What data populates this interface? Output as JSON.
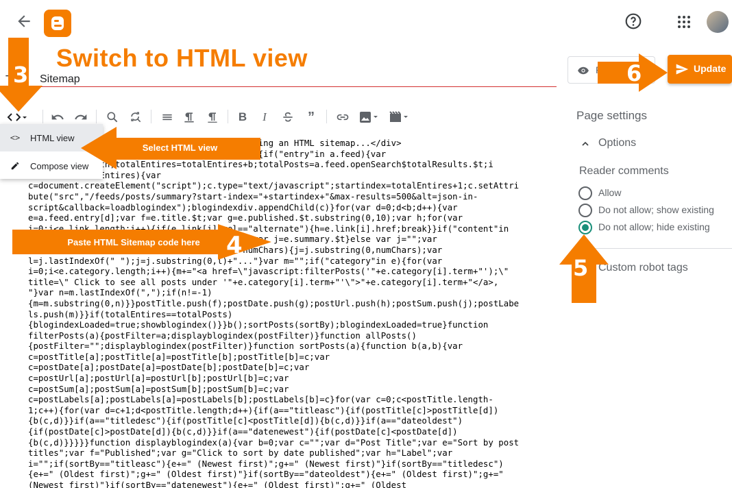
{
  "header": {
    "back_icon": "arrow-left-icon",
    "logo_icon": "blogger-logo-icon",
    "help_icon": "help-circle-icon",
    "apps_icon": "apps-grid-icon"
  },
  "title": {
    "prefix": "T",
    "text": "Sitemap"
  },
  "menu": {
    "html_view": "HTML view",
    "compose_view": "Compose view"
  },
  "code_lines": [
    "                                          lating an HTML sitemap...</div>",
    "                                          b(){if(\"entry\"in a.feed){var",
    "         .length;totalEntires=totalEntires+b;totalPosts=a.feed.openSearch$totalResults.$t;i",
    "         totalEntires){var",
    "c=document.createElement(\"script\");c.type=\"text/javascript\";startindex=totalEntires+1;c.setAttri",
    "bute(\"src\",\"/feeds/posts/summary?start-index=\"+startindex+\"&max-results=500&alt=json-in-",
    "script&callback=loadblogindex\");blogindexdiv.appendChild(c)}for(var d=0;d<b;d++){var",
    "e=a.feed.entry[d];var f=e.title.$t;var g=e.published.$t.substring(0,10);var h;for(var",
    "i=0;i<e.link.length;i++){if(e.link[i].rel==\"alternate\"){h=e.link[i].href;break}}if(\"content\"in",
    "                                          ){var j=e.summary.$t}else var j=\"\";var",
    "                                      gth>numChars){j=j.substring(0,numChars);var",
    "l=j.lastIndexOf(\" \");j=j.substring(0,l)+\"...\"}var m=\"\";if(\"category\"in e){for(var",
    "i=0;i<e.category.length;i++){m+=\"<a href=\\\"javascript:filterPosts('\"+e.category[i].term+\"');\\\"",
    "title=\\\" Click to see all posts under '\"+e.category[i].term+\"'\\\">\"+e.category[i].term+\"</a>,",
    "\"}var n=m.lastIndexOf(\",\");if(n!=-1)",
    "{m=m.substring(0,n)}}postTitle.push(f);postDate.push(g);postUrl.push(h);postSum.push(j);postLabe",
    "ls.push(m)}}if(totalEntires==totalPosts)",
    "{blogindexLoaded=true;showblogindex()}}b();sortPosts(sortBy);blogindexLoaded=true}function",
    "filterPosts(a){postFilter=a;displayblogindex(postFilter)}function allPosts()",
    "{postFilter=\"\";displayblogindex(postFilter)}function sortPosts(a){function b(a,b){var",
    "c=postTitle[a];postTitle[a]=postTitle[b];postTitle[b]=c;var",
    "c=postDate[a];postDate[a]=postDate[b];postDate[b]=c;var",
    "c=postUrl[a];postUrl[a]=postUrl[b];postUrl[b]=c;var",
    "c=postSum[a];postSum[a]=postSum[b];postSum[b]=c;var",
    "c=postLabels[a];postLabels[a]=postLabels[b];postLabels[b]=c}for(var c=0;c<postTitle.length-",
    "1;c++){for(var d=c+1;d<postTitle.length;d++){if(a==\"titleasc\"){if(postTitle[c]>postTitle[d])",
    "{b(c,d)}}if(a==\"titledesc\"){if(postTitle[c]<postTitle[d]){b(c,d)}}if(a==\"dateoldest\")",
    "{if(postDate[c]>postDate[d]){b(c,d)}}if(a==\"datenewest\"){if(postDate[c]<postDate[d])",
    "{b(c,d)}}}}}function displayblogindex(a){var b=0;var c=\"\";var d=\"Post Title\";var e=\"Sort by post",
    "titles\";var f=\"Published\";var g=\"Click to sort by date published\";var h=\"Label\";var",
    "i=\"\";if(sortBy==\"titleasc\"){e+=\" (Newest first)\";g+=\" (Newest first)\"}if(sortBy==\"titledesc\")",
    "{e+=\" (Oldest first)\";g+=\" (Oldest first)\"}if(sortBy==\"dateoldest\"){e+=\" (Oldest first)\";g+=\"",
    "(Newest first)\"}if(sortBy==\"datenewest\"){e+=\" (Oldest first)\";g+=\" (Oldest"
  ],
  "right_panel": {
    "preview_label": "P",
    "update_label": "Update",
    "page_settings": "Page settings",
    "options": "Options",
    "reader_comments": "Reader comments",
    "radio_allow": "Allow",
    "radio_show": "Do not allow; show existing",
    "radio_hide": "Do not allow; hide existing",
    "custom_robot_tags": "Custom robot tags"
  },
  "annotations": {
    "title": "Switch to HTML view",
    "step3": "3",
    "step4": "4",
    "step5": "5",
    "step6": "6",
    "select_html": "Select HTML view",
    "paste_html": "Paste HTML  Sitemap code here"
  },
  "colors": {
    "accent": "#f57d00",
    "radio_selected": "#1a8f7a",
    "title_underline": "#d32f2f"
  }
}
